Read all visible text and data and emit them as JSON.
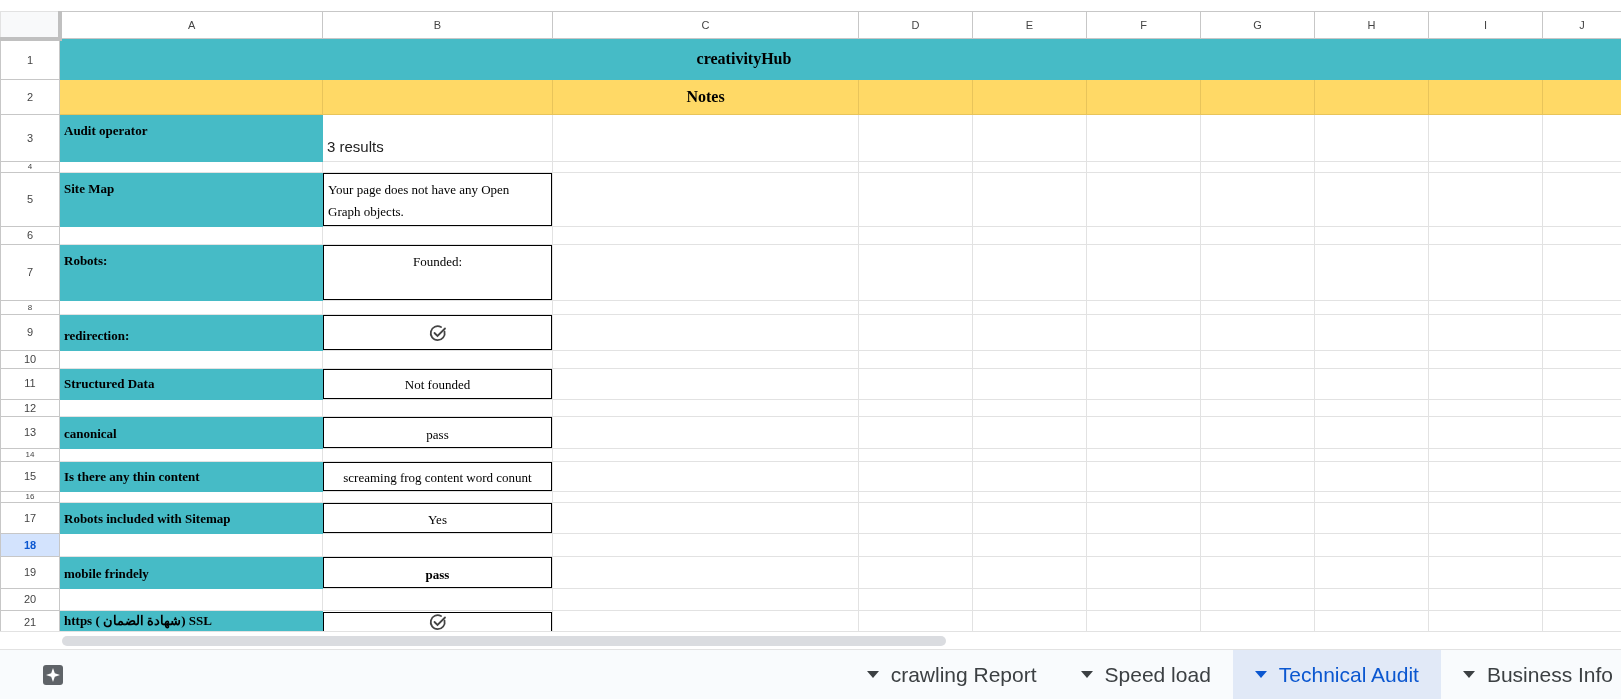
{
  "columns": [
    "A",
    "B",
    "C",
    "D",
    "E",
    "F",
    "G",
    "H",
    "I",
    "J"
  ],
  "rows": [
    {
      "number": "1",
      "selected": false,
      "kind": "title",
      "text": "creativityHub"
    },
    {
      "number": "2",
      "selected": false,
      "kind": "header",
      "text": "Notes"
    },
    {
      "number": "3",
      "selected": false,
      "kind": "item",
      "label": "Audit operator",
      "value": {
        "kind": "plain",
        "text": "3 results",
        "bold": false
      }
    },
    {
      "number": "4",
      "selected": false,
      "kind": "spacer"
    },
    {
      "number": "5",
      "selected": false,
      "kind": "item",
      "label": "Site Map",
      "value": {
        "kind": "wrapped",
        "text": "Your page does not have any Open Graph objects.",
        "bold": false
      }
    },
    {
      "number": "6",
      "selected": false,
      "kind": "spacer"
    },
    {
      "number": "7",
      "selected": false,
      "kind": "item",
      "label": "Robots:",
      "value": {
        "kind": "boxed",
        "text": "Founded:",
        "bold": false
      }
    },
    {
      "number": "8",
      "selected": false,
      "kind": "spacer"
    },
    {
      "number": "9",
      "selected": false,
      "kind": "item",
      "label": "redirection:",
      "value": {
        "kind": "check"
      }
    },
    {
      "number": "10",
      "selected": false,
      "kind": "spacer"
    },
    {
      "number": "11",
      "selected": false,
      "kind": "item",
      "label": "Structured Data",
      "value": {
        "kind": "boxed",
        "text": "Not founded",
        "bold": false
      }
    },
    {
      "number": "12",
      "selected": false,
      "kind": "spacer"
    },
    {
      "number": "13",
      "selected": false,
      "kind": "item",
      "label": "canonical",
      "value": {
        "kind": "boxed",
        "text": "pass",
        "bold": false
      }
    },
    {
      "number": "14",
      "selected": false,
      "kind": "spacer"
    },
    {
      "number": "15",
      "selected": false,
      "kind": "item",
      "label": "Is there any thin content",
      "value": {
        "kind": "boxed",
        "text": "screaming frog content word conunt",
        "bold": false
      }
    },
    {
      "number": "16",
      "selected": false,
      "kind": "spacer"
    },
    {
      "number": "17",
      "selected": false,
      "kind": "item",
      "label": "Robots included with Sitemap",
      "value": {
        "kind": "boxed",
        "text": "Yes",
        "bold": false
      }
    },
    {
      "number": "18",
      "selected": true,
      "kind": "spacer"
    },
    {
      "number": "19",
      "selected": false,
      "kind": "item",
      "label": "mobile frindely",
      "value": {
        "kind": "boxed",
        "text": "pass",
        "bold": true
      }
    },
    {
      "number": "20",
      "selected": false,
      "kind": "spacer"
    },
    {
      "number": "21",
      "selected": false,
      "kind": "item",
      "label": "https  ( شهادة الضمان) SSL",
      "value": {
        "kind": "check"
      }
    }
  ],
  "sheet_tabs": [
    {
      "label": "crawling Report",
      "selected": false
    },
    {
      "label": "Speed load",
      "selected": false
    },
    {
      "label": "Technical Audit",
      "selected": true
    },
    {
      "label": "Business Info",
      "selected": false
    }
  ]
}
